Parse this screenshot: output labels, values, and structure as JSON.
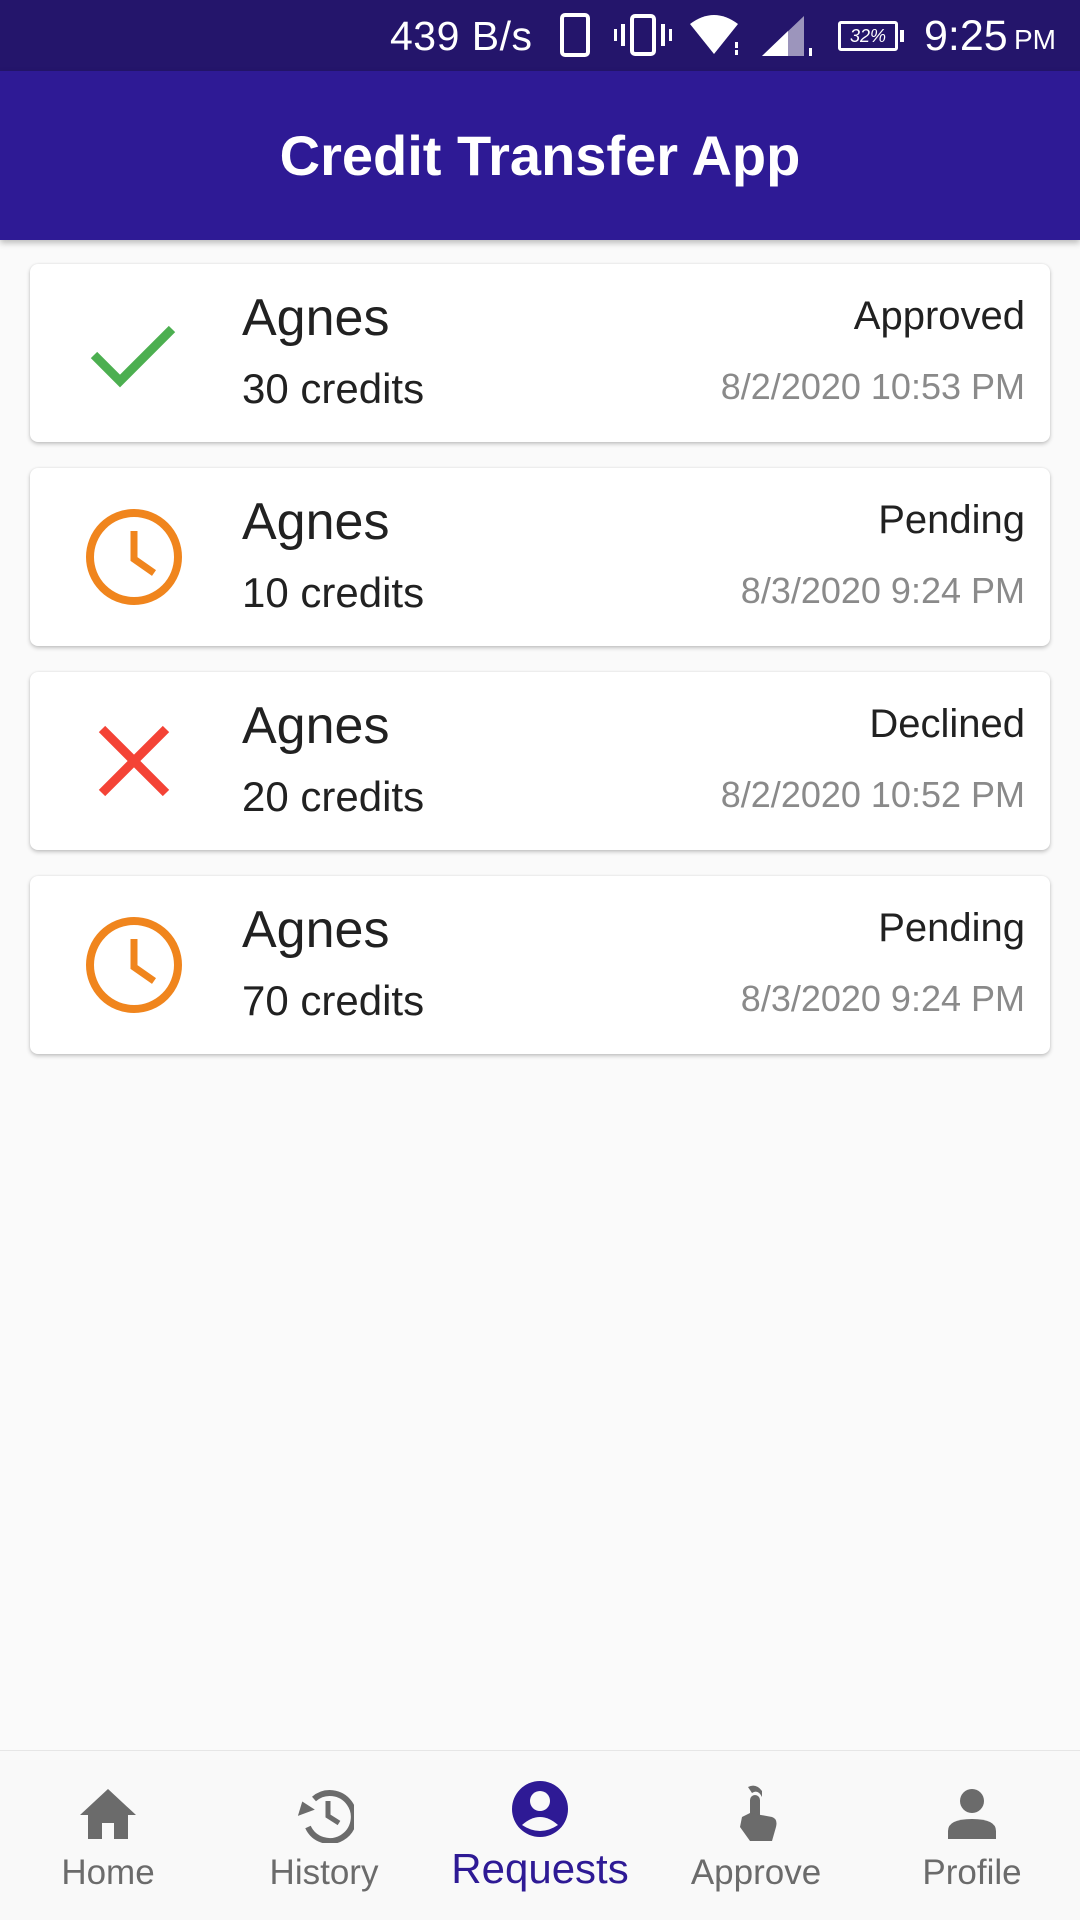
{
  "status_bar": {
    "network_speed": "439 B/s",
    "battery": "32%",
    "time": "9:25",
    "ampm": "PM"
  },
  "app_bar": {
    "title": "Credit Transfer App"
  },
  "colors": {
    "primary": "#2e1a95",
    "status_bar": "#24156b",
    "approved": "#4caf50",
    "pending": "#f0851d",
    "declined": "#f44336"
  },
  "requests": [
    {
      "name": "Agnes",
      "credits": "30 credits",
      "status": "Approved",
      "date": "8/2/2020 10:53 PM",
      "icon": "check-icon"
    },
    {
      "name": "Agnes",
      "credits": "10 credits",
      "status": "Pending",
      "date": "8/3/2020 9:24 PM",
      "icon": "clock-icon"
    },
    {
      "name": "Agnes",
      "credits": "20 credits",
      "status": "Declined",
      "date": "8/2/2020 10:52 PM",
      "icon": "close-icon"
    },
    {
      "name": "Agnes",
      "credits": "70 credits",
      "status": "Pending",
      "date": "8/3/2020 9:24 PM",
      "icon": "clock-icon"
    }
  ],
  "bottom_nav": {
    "items": [
      {
        "label": "Home",
        "icon": "home-icon"
      },
      {
        "label": "History",
        "icon": "history-icon"
      },
      {
        "label": "Requests",
        "icon": "account-circle-icon",
        "active": true
      },
      {
        "label": "Approve",
        "icon": "touch-icon"
      },
      {
        "label": "Profile",
        "icon": "person-icon"
      }
    ]
  }
}
